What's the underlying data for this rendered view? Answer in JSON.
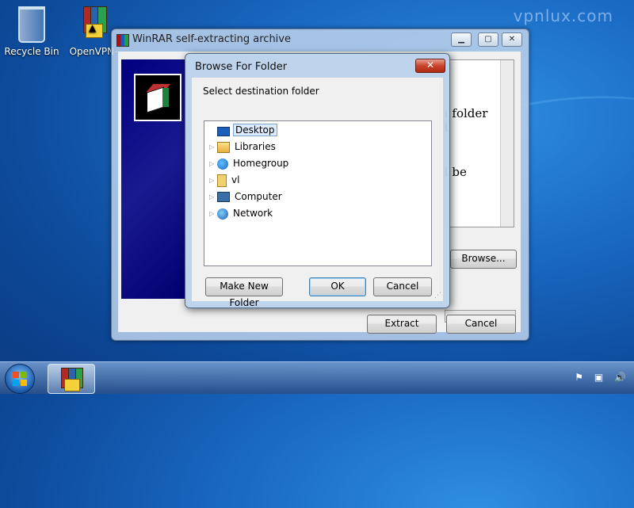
{
  "watermark": "vpnlux.com",
  "desktop": {
    "icons": [
      {
        "label": "Recycle Bin",
        "icon": "recycle-bin-icon"
      },
      {
        "label": "OpenVPN-",
        "icon": "winrar-archive-icon"
      }
    ]
  },
  "main_window": {
    "title": "WinRAR self-extracting archive",
    "text_fragments": [
      "n folder",
      "d",
      "ll be"
    ],
    "browse_label": "Browse...",
    "extract_label": "Extract",
    "cancel_label": "Cancel"
  },
  "dialog": {
    "title": "Browse For Folder",
    "close_glyph": "✕",
    "prompt": "Select destination folder",
    "tree": [
      {
        "label": "Desktop",
        "icon": "desktop-icon",
        "selected": true,
        "expandable": false
      },
      {
        "label": "Libraries",
        "icon": "libraries-icon",
        "selected": false,
        "expandable": true
      },
      {
        "label": "Homegroup",
        "icon": "homegroup-icon",
        "selected": false,
        "expandable": true
      },
      {
        "label": "vl",
        "icon": "user-folder-icon",
        "selected": false,
        "expandable": true
      },
      {
        "label": "Computer",
        "icon": "computer-icon",
        "selected": false,
        "expandable": true
      },
      {
        "label": "Network",
        "icon": "network-icon",
        "selected": false,
        "expandable": true
      }
    ],
    "new_folder_label": "Make New Folder",
    "ok_label": "OK",
    "cancel_label": "Cancel"
  },
  "taskbar": {
    "tray_icons": [
      "action-center-icon",
      "network-tray-icon",
      "volume-icon"
    ]
  },
  "colors": {
    "desktop_blue": "#1a6ac4",
    "banner_navy": "#000080",
    "selection": "#dcebfc"
  }
}
